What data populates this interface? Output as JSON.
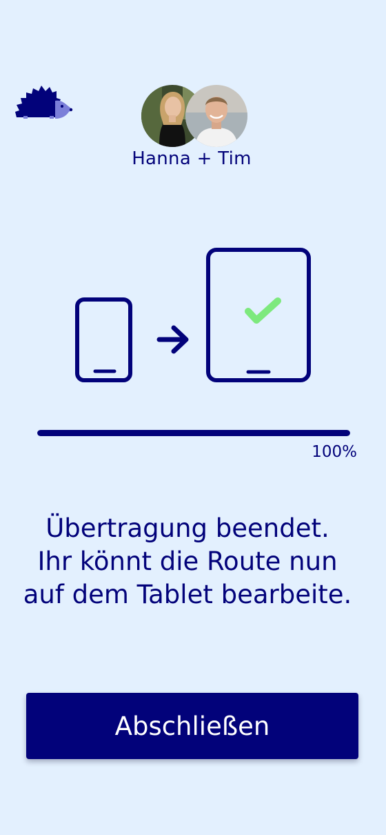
{
  "header": {
    "logo_icon": "hedgehog-icon",
    "participants": [
      {
        "name": "Hanna",
        "avatar_icon": "avatar-photo"
      },
      {
        "name": "Tim",
        "avatar_icon": "avatar-photo"
      }
    ],
    "participants_label": "Hanna + Tim"
  },
  "transfer": {
    "source_icon": "phone-icon",
    "arrow_icon": "arrow-right-icon",
    "target_icon": "tablet-icon",
    "status_icon": "checkmark-icon",
    "progress_value": 1.0,
    "progress_label": "100%"
  },
  "message": {
    "lines": [
      "Übertragung beendet.",
      "Ihr könnt die Route nun",
      "auf dem Tablet bearbeite."
    ]
  },
  "actions": {
    "finish_label": "Abschließen"
  },
  "colors": {
    "background": "#e3f0fe",
    "primary": "#02027a",
    "success": "#7de97d",
    "button_text": "#ffffff"
  }
}
